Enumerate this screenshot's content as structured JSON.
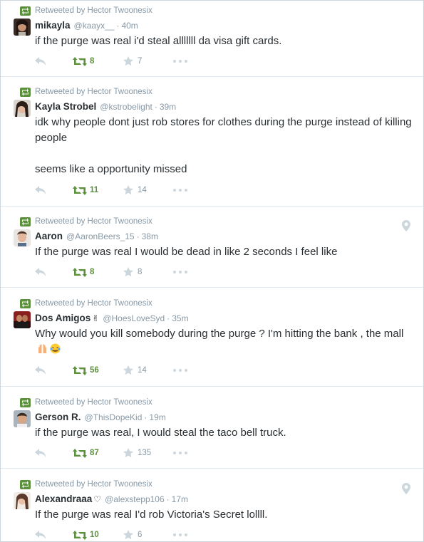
{
  "colors": {
    "accent_green": "#5c913b",
    "muted": "#8899a6",
    "text": "#292f33",
    "divider": "#e1e8ed"
  },
  "icons": [
    "retweet-icon",
    "reply-icon",
    "star-icon",
    "more-icon",
    "location-pin-icon"
  ],
  "tweets": [
    {
      "context": "Retweeted by Hector Twoonesix",
      "name": "mikayla",
      "badge": "",
      "handle": "@kaayx__",
      "sep": "·",
      "time": "40m",
      "text": "if the purge was real i'd steal alllllll da visa gift cards.",
      "retweets": "8",
      "favorites": "7",
      "has_location": false
    },
    {
      "context": "Retweeted by Hector Twoonesix",
      "name": "Kayla Strobel",
      "badge": "",
      "handle": "@kstrobelight",
      "sep": "·",
      "time": "39m",
      "text": "idk why people dont just rob stores for clothes during the purge instead of killing people\n\nseems like a opportunity missed",
      "retweets": "11",
      "favorites": "14",
      "has_location": false
    },
    {
      "context": "Retweeted by Hector Twoonesix",
      "name": "Aaron",
      "badge": "",
      "handle": "@AaronBeers_15",
      "sep": "·",
      "time": "38m",
      "text": "If the purge was real I would be dead in like 2 seconds I feel like",
      "retweets": "8",
      "favorites": "8",
      "has_location": true
    },
    {
      "context": "Retweeted by Hector Twoonesix",
      "name": "Dos Amigos",
      "badge": "✌",
      "handle": "@HoesLoveSyd",
      "sep": "·",
      "time": "35m",
      "text": "Why would you kill somebody during the purge ? I'm hitting the bank , the mall",
      "retweets": "56",
      "favorites": "14",
      "has_location": false
    },
    {
      "context": "Retweeted by Hector Twoonesix",
      "name": "Gerson R.",
      "badge": "",
      "handle": "@ThisDopeKid",
      "sep": "·",
      "time": "19m",
      "text": "if the purge was real, I would steal the taco bell truck.",
      "retweets": "87",
      "favorites": "135",
      "has_location": false
    },
    {
      "context": "Retweeted by Hector Twoonesix",
      "name": "Alexandraaa",
      "badge": "♡",
      "handle": "@alexstepp106",
      "sep": "·",
      "time": "17m",
      "text": "If the purge was real I'd rob Victoria's Secret lollll.",
      "retweets": "10",
      "favorites": "6",
      "has_location": true
    }
  ]
}
